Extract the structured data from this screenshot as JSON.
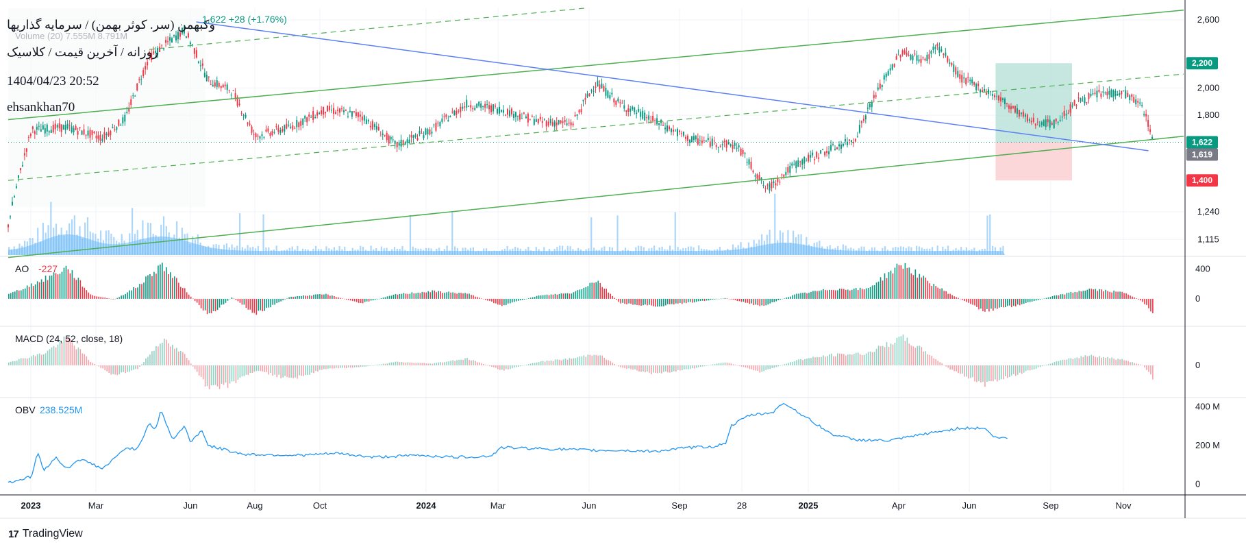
{
  "header": {
    "title": "وکبهمن (سر. کوثر بهمن) / سرمایه گذاریها",
    "subtitle": "روزانه / آخرین قیمت / کلاسیک",
    "datetime": "1404/04/23 20:52",
    "author": "ehsankhan70",
    "ohlc_change": "1,622  +28 (+1.76%)",
    "volume_label": "Volume (20)  7.555M  8.791M"
  },
  "indicators": {
    "ao_label": "AO",
    "ao_value": "-227",
    "macd_label": "MACD (24, 52, close, 18)",
    "obv_label": "OBV",
    "obv_value": "238.525M"
  },
  "branding": {
    "logo_text": "TradingView",
    "logo_icon": "tradingview-logo-icon"
  },
  "colors": {
    "up": "#089981",
    "down": "#f23645",
    "trend_green": "#4caf50",
    "trend_blue": "#5b7ff7",
    "volume": "#90caf9",
    "obv": "#2196f3",
    "target_zone": "#b2dfd5",
    "stop_zone": "#fbd0d4",
    "price_badge_current": "#089981",
    "price_badge_last": "#787b86",
    "price_badge_target": "#089981",
    "price_badge_stop": "#f23645"
  },
  "chart_data": {
    "type": "candlestick",
    "price_axis": {
      "scale": "log",
      "ticks": [
        "2,600",
        "2,000",
        "1,800",
        "1,240",
        "1,115"
      ],
      "tick_values": [
        2600,
        2000,
        1800,
        1240,
        1115
      ],
      "ylim": [
        1050,
        2720
      ]
    },
    "price_badges": [
      {
        "label": "2,200",
        "value": 2200,
        "kind": "target"
      },
      {
        "label": "1,622",
        "value": 1622,
        "kind": "current"
      },
      {
        "label": "1,619",
        "value": 1619,
        "kind": "last"
      },
      {
        "label": "1,400",
        "value": 1400,
        "kind": "stop"
      }
    ],
    "time_axis": {
      "labels": [
        "2023",
        "Mar",
        "Jun",
        "Aug",
        "Oct",
        "2024",
        "Mar",
        "Jun",
        "Sep",
        "28",
        "2025",
        "Apr",
        "Jun",
        "Sep",
        "Nov"
      ],
      "bold": [
        "2023",
        "2024",
        "2025"
      ]
    },
    "price_path": [
      [
        0,
        1180
      ],
      [
        0.02,
        1700
      ],
      [
        0.05,
        1720
      ],
      [
        0.08,
        1650
      ],
      [
        0.1,
        1780
      ],
      [
        0.12,
        2250
      ],
      [
        0.15,
        2500
      ],
      [
        0.17,
        2060
      ],
      [
        0.19,
        1980
      ],
      [
        0.21,
        1660
      ],
      [
        0.24,
        1720
      ],
      [
        0.27,
        1840
      ],
      [
        0.3,
        1800
      ],
      [
        0.33,
        1600
      ],
      [
        0.36,
        1700
      ],
      [
        0.39,
        1880
      ],
      [
        0.42,
        1840
      ],
      [
        0.45,
        1760
      ],
      [
        0.48,
        1740
      ],
      [
        0.5,
        2040
      ],
      [
        0.52,
        1880
      ],
      [
        0.55,
        1760
      ],
      [
        0.58,
        1640
      ],
      [
        0.6,
        1620
      ],
      [
        0.62,
        1600
      ],
      [
        0.645,
        1350
      ],
      [
        0.67,
        1490
      ],
      [
        0.7,
        1580
      ],
      [
        0.72,
        1640
      ],
      [
        0.74,
        1980
      ],
      [
        0.76,
        2300
      ],
      [
        0.78,
        2220
      ],
      [
        0.79,
        2360
      ],
      [
        0.81,
        2080
      ],
      [
        0.84,
        1940
      ],
      [
        0.87,
        1760
      ],
      [
        0.89,
        1740
      ],
      [
        0.91,
        1900
      ],
      [
        0.93,
        1960
      ],
      [
        0.95,
        1960
      ],
      [
        0.965,
        1860
      ],
      [
        0.975,
        1622
      ]
    ],
    "trendlines": [
      {
        "color": "green",
        "style": "solid",
        "from": [
          0,
          1770
        ],
        "to": [
          1,
          2700
        ]
      },
      {
        "color": "green",
        "style": "solid",
        "from": [
          0,
          1040
        ],
        "to": [
          1,
          1660
        ]
      },
      {
        "color": "green",
        "style": "dashed",
        "from": [
          0,
          1400
        ],
        "to": [
          1,
          2110
        ]
      },
      {
        "color": "green",
        "style": "dashed",
        "from": [
          0.12,
          2320
        ],
        "to": [
          0.49,
          2720
        ]
      },
      {
        "color": "blue",
        "style": "solid",
        "from": [
          0.16,
          2580
        ],
        "to": [
          0.97,
          1570
        ]
      }
    ],
    "position_tool": {
      "x_start": 0.84,
      "x_end": 0.905,
      "entry": 1622,
      "target": 2200,
      "stop": 1400
    },
    "panes": [
      {
        "name": "AO",
        "ticks": [
          "400",
          "0"
        ]
      },
      {
        "name": "MACD",
        "ticks": [
          "0"
        ]
      },
      {
        "name": "OBV",
        "ticks": [
          "400 M",
          "200 M",
          "0"
        ]
      }
    ],
    "ao_path": [
      [
        0,
        60
      ],
      [
        0.03,
        260
      ],
      [
        0.05,
        420
      ],
      [
        0.07,
        50
      ],
      [
        0.09,
        -10
      ],
      [
        0.11,
        170
      ],
      [
        0.13,
        460
      ],
      [
        0.15,
        120
      ],
      [
        0.17,
        -230
      ],
      [
        0.19,
        20
      ],
      [
        0.21,
        -200
      ],
      [
        0.24,
        30
      ],
      [
        0.27,
        60
      ],
      [
        0.3,
        -60
      ],
      [
        0.33,
        60
      ],
      [
        0.36,
        100
      ],
      [
        0.39,
        70
      ],
      [
        0.42,
        -90
      ],
      [
        0.45,
        40
      ],
      [
        0.48,
        80
      ],
      [
        0.5,
        250
      ],
      [
        0.52,
        -60
      ],
      [
        0.55,
        -100
      ],
      [
        0.58,
        -50
      ],
      [
        0.61,
        10
      ],
      [
        0.64,
        -100
      ],
      [
        0.67,
        60
      ],
      [
        0.7,
        130
      ],
      [
        0.73,
        130
      ],
      [
        0.76,
        470
      ],
      [
        0.78,
        250
      ],
      [
        0.8,
        70
      ],
      [
        0.83,
        -160
      ],
      [
        0.86,
        -80
      ],
      [
        0.89,
        40
      ],
      [
        0.92,
        130
      ],
      [
        0.95,
        80
      ],
      [
        0.965,
        -40
      ],
      [
        0.975,
        -227
      ]
    ],
    "ao_ylim": [
      -350,
      550
    ],
    "macd_path": [
      [
        0,
        20
      ],
      [
        0.03,
        70
      ],
      [
        0.05,
        160
      ],
      [
        0.07,
        20
      ],
      [
        0.09,
        -60
      ],
      [
        0.11,
        -20
      ],
      [
        0.13,
        150
      ],
      [
        0.15,
        60
      ],
      [
        0.17,
        -140
      ],
      [
        0.19,
        -110
      ],
      [
        0.21,
        -30
      ],
      [
        0.24,
        -80
      ],
      [
        0.27,
        -20
      ],
      [
        0.3,
        -10
      ],
      [
        0.33,
        20
      ],
      [
        0.36,
        10
      ],
      [
        0.39,
        40
      ],
      [
        0.42,
        -30
      ],
      [
        0.45,
        20
      ],
      [
        0.48,
        40
      ],
      [
        0.5,
        70
      ],
      [
        0.52,
        -10
      ],
      [
        0.55,
        -50
      ],
      [
        0.58,
        -20
      ],
      [
        0.61,
        20
      ],
      [
        0.64,
        -40
      ],
      [
        0.67,
        30
      ],
      [
        0.7,
        60
      ],
      [
        0.73,
        70
      ],
      [
        0.76,
        160
      ],
      [
        0.78,
        80
      ],
      [
        0.8,
        -20
      ],
      [
        0.83,
        -110
      ],
      [
        0.86,
        -50
      ],
      [
        0.89,
        20
      ],
      [
        0.92,
        60
      ],
      [
        0.95,
        30
      ],
      [
        0.965,
        0
      ],
      [
        0.975,
        -90
      ]
    ],
    "macd_ylim": [
      -180,
      220
    ],
    "obv_path": [
      [
        0,
        10
      ],
      [
        0.02,
        40
      ],
      [
        0.025,
        170
      ],
      [
        0.03,
        70
      ],
      [
        0.04,
        140
      ],
      [
        0.05,
        80
      ],
      [
        0.06,
        130
      ],
      [
        0.07,
        110
      ],
      [
        0.08,
        80
      ],
      [
        0.09,
        130
      ],
      [
        0.1,
        190
      ],
      [
        0.11,
        180
      ],
      [
        0.12,
        320
      ],
      [
        0.125,
        280
      ],
      [
        0.13,
        380
      ],
      [
        0.14,
        230
      ],
      [
        0.15,
        300
      ],
      [
        0.155,
        220
      ],
      [
        0.165,
        280
      ],
      [
        0.17,
        200
      ],
      [
        0.2,
        155
      ],
      [
        0.25,
        150
      ],
      [
        0.28,
        160
      ],
      [
        0.31,
        140
      ],
      [
        0.35,
        150
      ],
      [
        0.38,
        140
      ],
      [
        0.41,
        145
      ],
      [
        0.42,
        190
      ],
      [
        0.45,
        185
      ],
      [
        0.5,
        175
      ],
      [
        0.52,
        175
      ],
      [
        0.55,
        170
      ],
      [
        0.58,
        190
      ],
      [
        0.6,
        195
      ],
      [
        0.61,
        210
      ],
      [
        0.615,
        300
      ],
      [
        0.63,
        355
      ],
      [
        0.65,
        370
      ],
      [
        0.66,
        420
      ],
      [
        0.68,
        340
      ],
      [
        0.7,
        260
      ],
      [
        0.72,
        230
      ],
      [
        0.75,
        225
      ],
      [
        0.78,
        260
      ],
      [
        0.81,
        290
      ],
      [
        0.83,
        290
      ],
      [
        0.84,
        240
      ],
      [
        0.85,
        238
      ]
    ],
    "obv_ylim": [
      -40,
      440
    ],
    "volume_bars": "spiky bars with smoothed area average along bottom of price pane"
  }
}
